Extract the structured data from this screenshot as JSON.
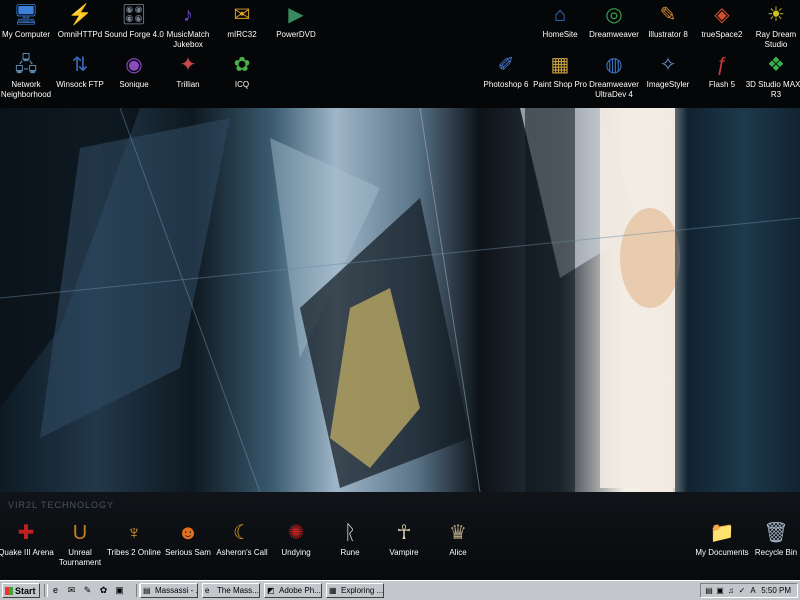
{
  "desktop": {
    "top_icons_left": [
      {
        "label": "My Computer",
        "icon": "computer-icon",
        "glyph": "🖥",
        "color": "#3d7fd8"
      },
      {
        "label": "OmniHTTPd",
        "icon": "lightning-icon",
        "glyph": "⚡",
        "color": "#e8c020"
      },
      {
        "label": "Sound Forge 4.0",
        "icon": "sound-forge-icon",
        "glyph": "🎛",
        "color": "#7a8a98"
      },
      {
        "label": "MusicMatch Jukebox",
        "icon": "music-icon",
        "glyph": "♪",
        "color": "#6b48c8"
      },
      {
        "label": "mIRC32",
        "icon": "mirc-icon",
        "glyph": "✉",
        "color": "#d8a020"
      },
      {
        "label": "PowerDVD",
        "icon": "dvd-icon",
        "glyph": "▶",
        "color": "#3a8a60"
      },
      {
        "label": "Network Neighborhood",
        "icon": "network-icon",
        "glyph": "🖧",
        "color": "#5a8ab0"
      },
      {
        "label": "Winsock FTP",
        "icon": "ftp-icon",
        "glyph": "⇅",
        "color": "#3a6ac0"
      },
      {
        "label": "Sonique",
        "icon": "sonique-icon",
        "glyph": "◉",
        "color": "#8a4ac0"
      },
      {
        "label": "Trillian",
        "icon": "trillian-icon",
        "glyph": "✦",
        "color": "#c84a4a"
      },
      {
        "label": "ICQ",
        "icon": "icq-icon",
        "glyph": "✿",
        "color": "#4ab04a"
      }
    ],
    "top_icons_right": [
      {
        "label": "HomeSite",
        "icon": "homesite-icon",
        "glyph": "⌂",
        "color": "#3a7ad0"
      },
      {
        "label": "Dreamweaver",
        "icon": "dreamweaver-icon",
        "glyph": "◎",
        "color": "#3aa04a"
      },
      {
        "label": "Illustrator 8",
        "icon": "illustrator-icon",
        "glyph": "✎",
        "color": "#d08a30"
      },
      {
        "label": "trueSpace2",
        "icon": "truespace-icon",
        "glyph": "◈",
        "color": "#d05030"
      },
      {
        "label": "Ray Dream Studio",
        "icon": "raydream-icon",
        "glyph": "☀",
        "color": "#d0c030"
      },
      {
        "label": "Photoshop 6",
        "icon": "photoshop-icon",
        "glyph": "✐",
        "color": "#4a7ad8"
      },
      {
        "label": "Paint Shop Pro",
        "icon": "paintshop-icon",
        "glyph": "▦",
        "color": "#c8a040"
      },
      {
        "label": "Dreamweaver UltraDev 4",
        "icon": "ultradev-icon",
        "glyph": "◍",
        "color": "#3a70c0"
      },
      {
        "label": "ImageStyler",
        "icon": "imagestyler-icon",
        "glyph": "✧",
        "color": "#6a8ac8"
      },
      {
        "label": "Flash 5",
        "icon": "flash-icon",
        "glyph": "ƒ",
        "color": "#c83a3a"
      },
      {
        "label": "3D Studio MAX® R3",
        "icon": "3dsmax-icon",
        "glyph": "❖",
        "color": "#3ab04a"
      }
    ],
    "bottom_icons": [
      {
        "label": "Quake III Arena",
        "icon": "quake-icon",
        "glyph": "✚",
        "color": "#c02020"
      },
      {
        "label": "Unreal Tournament",
        "icon": "unreal-icon",
        "glyph": "U",
        "color": "#c08020"
      },
      {
        "label": "Tribes 2 Online",
        "icon": "tribes-icon",
        "glyph": "♆",
        "color": "#d89030"
      },
      {
        "label": "Serious Sam",
        "icon": "serious-sam-icon",
        "glyph": "☻",
        "color": "#e07020"
      },
      {
        "label": "Asheron's Call",
        "icon": "asherons-icon",
        "glyph": "☾",
        "color": "#d8a020"
      },
      {
        "label": "Undying",
        "icon": "undying-icon",
        "glyph": "✺",
        "color": "#b02020"
      },
      {
        "label": "Rune",
        "icon": "rune-icon",
        "glyph": "ᚱ",
        "color": "#d0d0d0"
      },
      {
        "label": "Vampire",
        "icon": "vampire-icon",
        "glyph": "☥",
        "color": "#e0d0b0"
      },
      {
        "label": "Alice",
        "icon": "alice-icon",
        "glyph": "♛",
        "color": "#b0a080"
      }
    ],
    "bottom_right_icons": [
      {
        "label": "My Documents",
        "icon": "documents-icon",
        "glyph": "📁",
        "color": "#8aa0c8"
      },
      {
        "label": "Recycle Bin",
        "icon": "recycle-bin-icon",
        "glyph": "🗑",
        "color": "#a0b0c0"
      }
    ],
    "wallpaper_text": "VIR2L TECHNOLOGY"
  },
  "taskbar": {
    "start_label": "Start",
    "quick_launch": [
      {
        "icon": "ie-icon",
        "glyph": "e"
      },
      {
        "icon": "outlook-icon",
        "glyph": "✉"
      },
      {
        "icon": "pencil-icon",
        "glyph": "✎"
      },
      {
        "icon": "paint-icon",
        "glyph": "✿"
      },
      {
        "icon": "desktop-icon",
        "glyph": "▣"
      }
    ],
    "tasks": [
      {
        "label": "Massassi - ...",
        "icon": "window-icon",
        "glyph": "▤"
      },
      {
        "label": "The Mass...",
        "icon": "ie-icon",
        "glyph": "e"
      },
      {
        "label": "Adobe Ph...",
        "icon": "photoshop-icon",
        "glyph": "◩"
      },
      {
        "label": "Exploring ...",
        "icon": "folder-icon",
        "glyph": "▦"
      }
    ],
    "tray_icons": [
      {
        "icon": "network-tray-icon",
        "glyph": "▤"
      },
      {
        "icon": "monitor-tray-icon",
        "glyph": "▣"
      },
      {
        "icon": "speaker-icon",
        "glyph": "♫"
      },
      {
        "icon": "check-tray-icon",
        "glyph": "✓"
      },
      {
        "icon": "acrobat-tray-icon",
        "glyph": "A"
      }
    ],
    "clock": "5:50 PM"
  }
}
